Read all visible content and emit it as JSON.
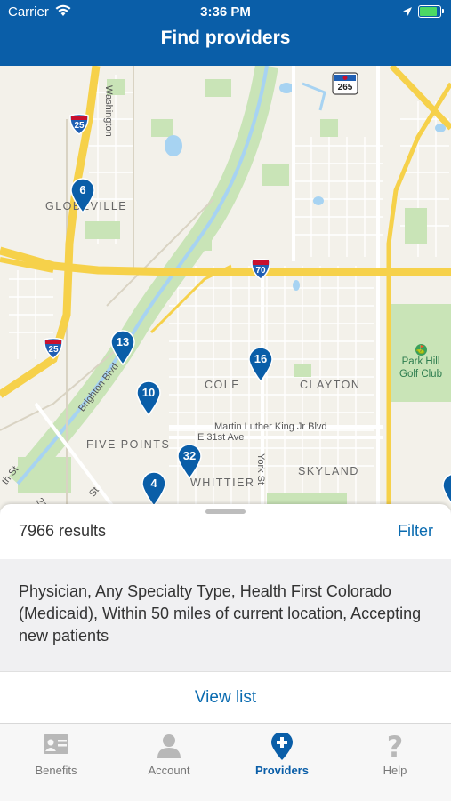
{
  "status_bar": {
    "carrier": "Carrier",
    "time": "3:36 PM"
  },
  "header": {
    "title": "Find providers"
  },
  "map": {
    "pins": [
      {
        "count": "6"
      },
      {
        "count": "13"
      },
      {
        "count": "10"
      },
      {
        "count": "16"
      },
      {
        "count": "32"
      },
      {
        "count": "4"
      }
    ],
    "area_labels": {
      "globeville": "GLOBEVILLE",
      "cole": "COLE",
      "clayton": "CLAYTON",
      "five_points": "FIVE POINTS",
      "whittier": "WHITTIER",
      "skyland": "SKYLAND"
    },
    "streets": {
      "washington": "Washington",
      "brighton": "Brighton Blvd",
      "mlk": "Martin Luther King Jr Blvd",
      "e31st": "E 31st Ave",
      "york": "York St",
      "22nd": "22nd St",
      "th_st": "th St",
      "st": "St"
    },
    "park": "Park Hill Golf Club",
    "shields": {
      "i25_top": "25",
      "i25_bottom": "25",
      "i70": "70",
      "us265": "265"
    }
  },
  "sheet": {
    "results": "7966 results",
    "filter_label": "Filter",
    "summary": "Physician, Any Specialty Type, Health First Colorado (Medicaid), Within 50 miles of current location, Accepting new patients",
    "view_list_label": "View list"
  },
  "tabs": [
    {
      "label": "Benefits",
      "icon": "id-card-icon"
    },
    {
      "label": "Account",
      "icon": "person-icon"
    },
    {
      "label": "Providers",
      "icon": "location-plus-icon",
      "active": true
    },
    {
      "label": "Help",
      "icon": "question-icon"
    }
  ],
  "colors": {
    "brand": "#0a5ea8",
    "link": "#0a6bb0",
    "pin": "#0a5ea8",
    "highway": "#f6d14a",
    "water": "#a7d3f2",
    "park": "#c9e4b7"
  }
}
